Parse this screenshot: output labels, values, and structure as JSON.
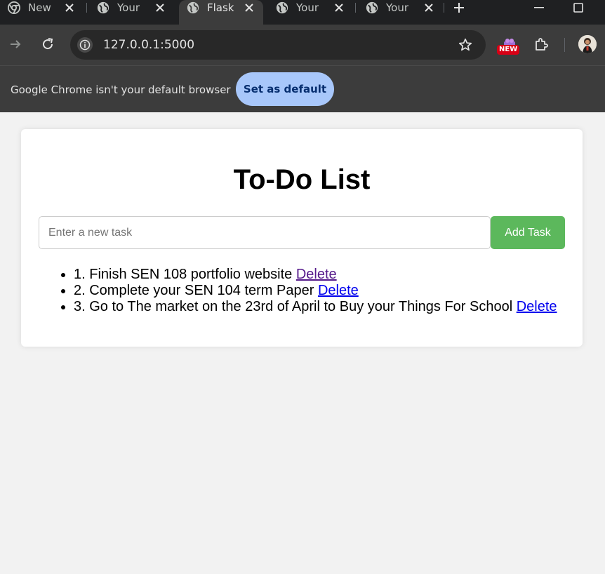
{
  "browser": {
    "tabs": [
      {
        "title": "New T"
      },
      {
        "title": "Your N"
      },
      {
        "title": "Flask"
      },
      {
        "title": "Your N"
      },
      {
        "title": "Your N"
      }
    ],
    "url": "127.0.0.1:5000",
    "extension_badge": "NEW",
    "infobar": {
      "message": "Google Chrome isn't your default browser",
      "button": "Set as default"
    }
  },
  "app": {
    "title": "To-Do List",
    "input_placeholder": "Enter a new task",
    "add_button": "Add Task",
    "tasks": [
      {
        "text": "1. Finish SEN 108 portfolio website",
        "delete_label": "Delete"
      },
      {
        "text": "2. Complete your SEN 104 term Paper",
        "delete_label": "Delete"
      },
      {
        "text": "3. Go to The market on the 23rd of April to Buy your Things For School",
        "delete_label": "Delete"
      }
    ]
  },
  "colors": {
    "add_button": "#5cb85c",
    "link": "#0000ee",
    "visited_link": "#551a8b",
    "infobar_button": "#a8c7fa"
  }
}
